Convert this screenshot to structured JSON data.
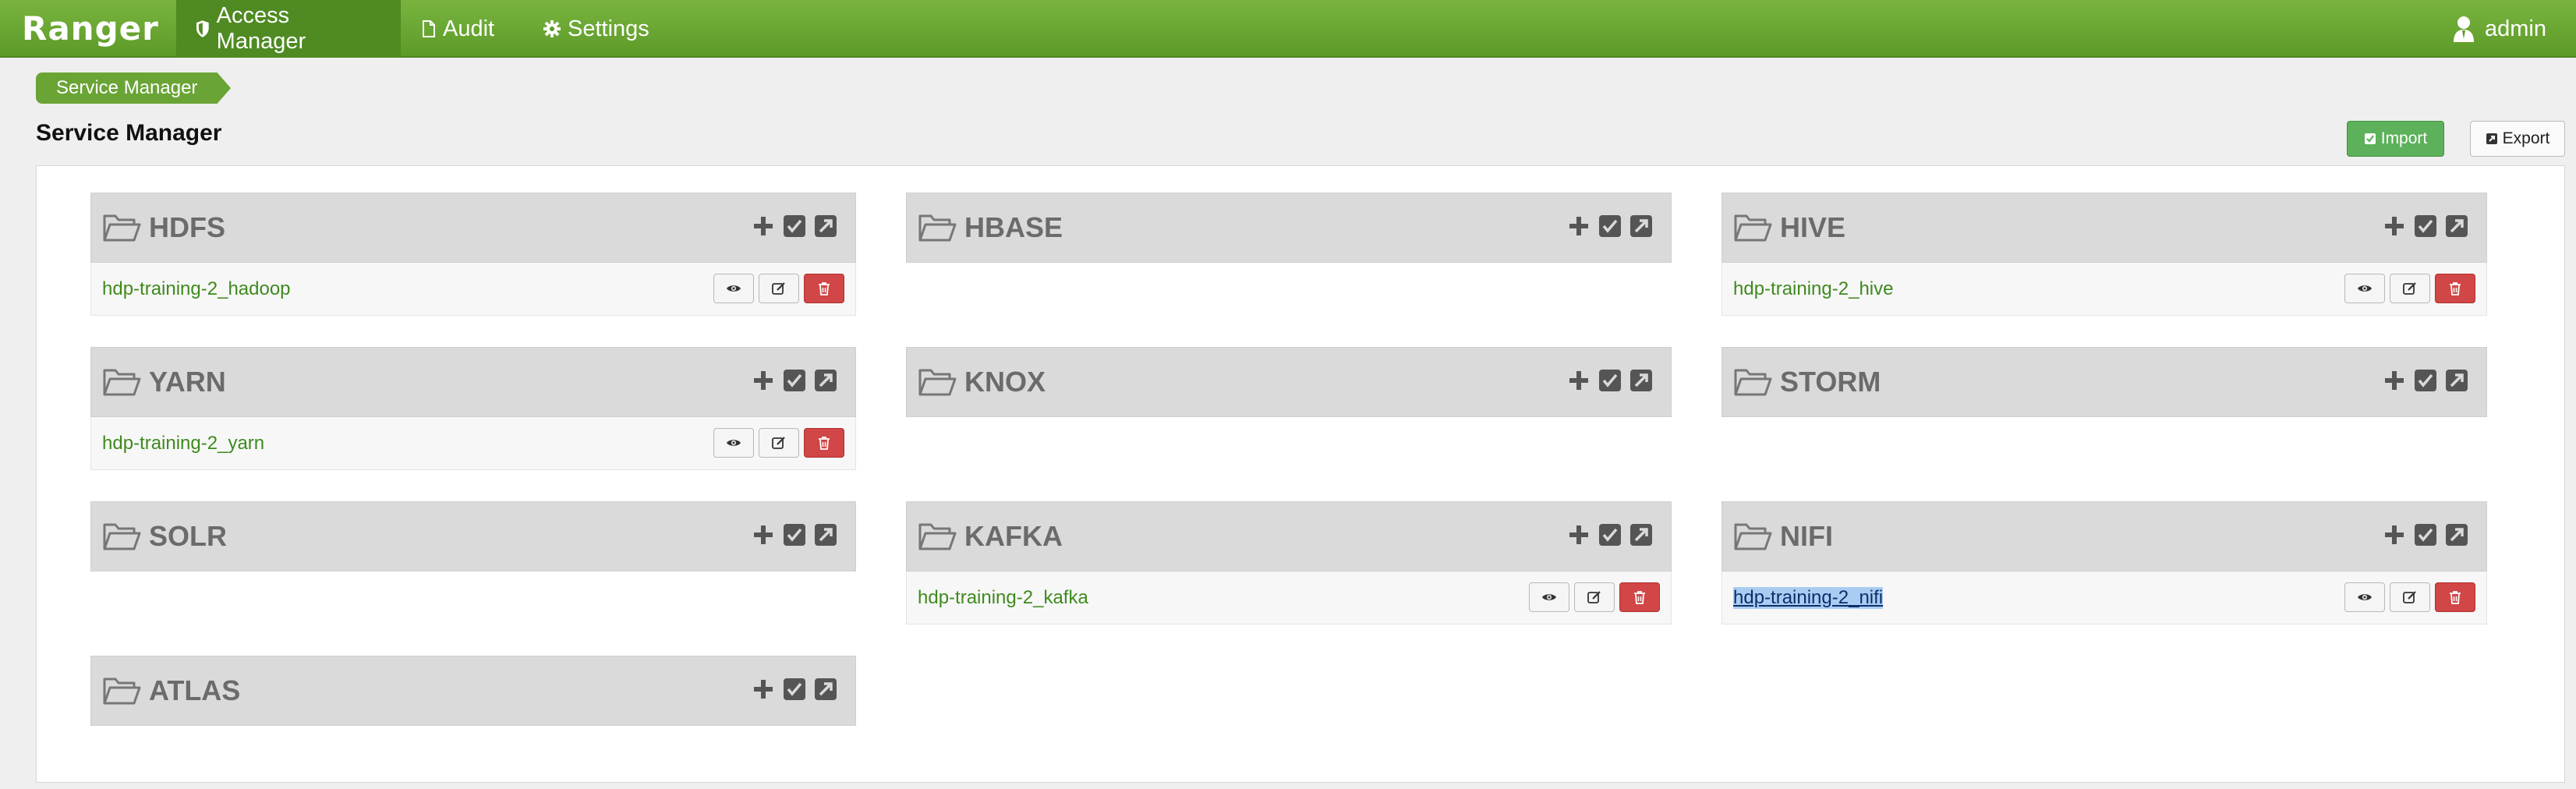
{
  "navbar": {
    "brand": "Ranger",
    "items": [
      {
        "label": "Access Manager",
        "icon": "shield-icon"
      },
      {
        "label": "Audit",
        "icon": "file-icon"
      },
      {
        "label": "Settings",
        "icon": "gear-icon"
      }
    ],
    "user": {
      "label": "admin",
      "icon": "user-icon"
    }
  },
  "breadcrumb": "Service Manager",
  "page_title": "Service Manager",
  "toolbar": {
    "import_label": "Import",
    "export_label": "Export"
  },
  "services": {
    "hdfs": {
      "title": "HDFS",
      "items": [
        "hdp-training-2_hadoop"
      ]
    },
    "hbase": {
      "title": "HBASE",
      "items": []
    },
    "hive": {
      "title": "HIVE",
      "items": [
        "hdp-training-2_hive"
      ]
    },
    "yarn": {
      "title": "YARN",
      "items": [
        "hdp-training-2_yarn"
      ]
    },
    "knox": {
      "title": "KNOX",
      "items": []
    },
    "storm": {
      "title": "STORM",
      "items": []
    },
    "solr": {
      "title": "SOLR",
      "items": []
    },
    "kafka": {
      "title": "KAFKA",
      "items": [
        "hdp-training-2_kafka"
      ]
    },
    "nifi": {
      "title": "NIFI",
      "items": [
        "hdp-training-2_nifi"
      ]
    },
    "atlas": {
      "title": "ATLAS",
      "items": []
    }
  },
  "colors": {
    "navbar": "#6aa435",
    "link": "#3f8a1e",
    "danger": "#d14646",
    "import": "#5cb15a"
  }
}
